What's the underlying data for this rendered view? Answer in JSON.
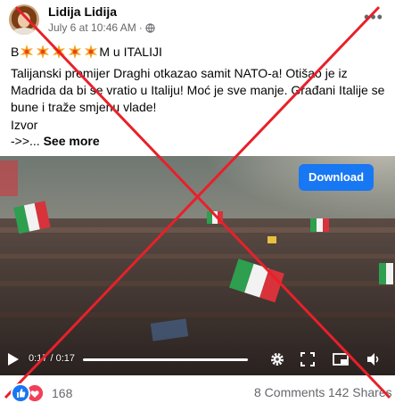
{
  "post": {
    "author": "Lidija Lidija",
    "timestamp": "July 6 at 10:46 AM",
    "separator": "·",
    "more_label": "•••",
    "headline_first": "B",
    "headline_last": "M u ITALIJI",
    "body": " Talijanski premijer Draghi otkazao samit NATO-a! Otišao je iz Madrida da bi se vratio u Italiju! Moć je sve manje. Građani Italije se bune i traže smjenu vlade!",
    "source_label": "Izvor",
    "source_arrow": "->>...",
    "see_more": "See more"
  },
  "video": {
    "download_label": "Download",
    "time": "0:17 / 0:17",
    "progress": 1.0
  },
  "footer": {
    "reaction_count": "168",
    "comments": "8 Comments",
    "shares": "142 Shares"
  },
  "colors": {
    "accent": "#1877f2",
    "like": "#1877f2",
    "love": "#f33e58",
    "cross": "#e8202a"
  },
  "icons": [
    "globe-icon",
    "more-options-icon",
    "burst-icon",
    "play-icon",
    "settings-icon",
    "fullscreen-icon",
    "pip-icon",
    "volume-icon",
    "like-icon",
    "love-icon"
  ]
}
